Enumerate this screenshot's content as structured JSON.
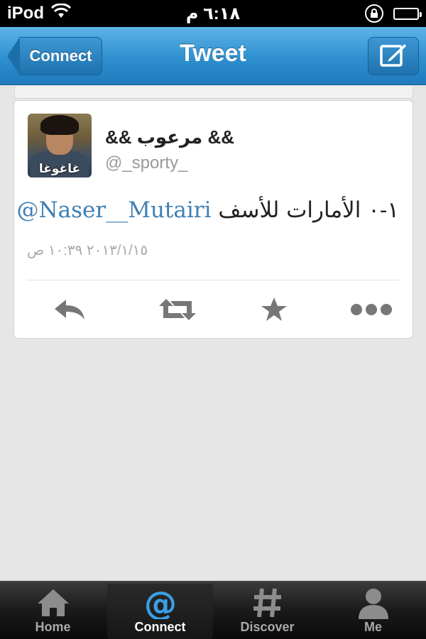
{
  "status_bar": {
    "carrier": "iPod",
    "time": "٦:١٨ م"
  },
  "nav": {
    "title": "Tweet",
    "back_label": "Connect"
  },
  "tweet": {
    "display_name": "&& مرعوب &&",
    "handle": "@_sporty_",
    "avatar_caption": "غاغوغا",
    "mention": "@Naser__Mutairi",
    "text": "١-٠ الأمارات للأسف",
    "timestamp": "٢٠١٣/١/١٥ ١٠:٣٩ ص"
  },
  "tabs": [
    {
      "label": "Home",
      "icon": "home-icon",
      "active": false
    },
    {
      "label": "Connect",
      "icon": "at-icon",
      "active": true
    },
    {
      "label": "Discover",
      "icon": "hash-icon",
      "active": false
    },
    {
      "label": "Me",
      "icon": "person-icon",
      "active": false
    }
  ],
  "colors": {
    "accent": "#2e8fcf",
    "mention": "#3f7fb3",
    "active_tab_icon": "#3aa0e6"
  }
}
